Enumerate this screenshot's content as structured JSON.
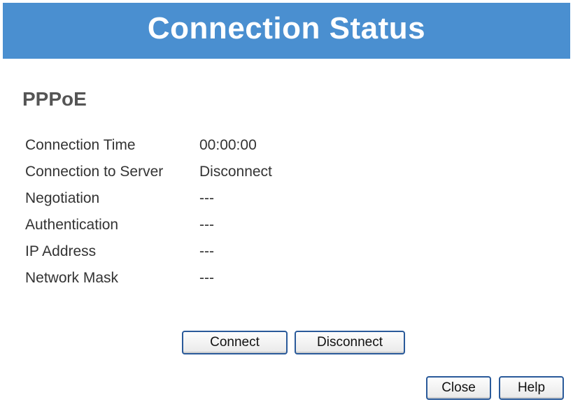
{
  "header": {
    "title": "Connection Status",
    "background_color": "#4a8fd0"
  },
  "section": {
    "title": "PPPoE"
  },
  "status_rows": [
    {
      "label": "Connection Time",
      "value": "00:00:00"
    },
    {
      "label": "Connection to Server",
      "value": "Disconnect"
    },
    {
      "label": "Negotiation",
      "value": "---"
    },
    {
      "label": "Authentication",
      "value": "---"
    },
    {
      "label": "IP Address",
      "value": "---"
    },
    {
      "label": "Network Mask",
      "value": "---"
    }
  ],
  "buttons": {
    "connect": "Connect",
    "disconnect": "Disconnect",
    "close": "Close",
    "help": "Help"
  }
}
